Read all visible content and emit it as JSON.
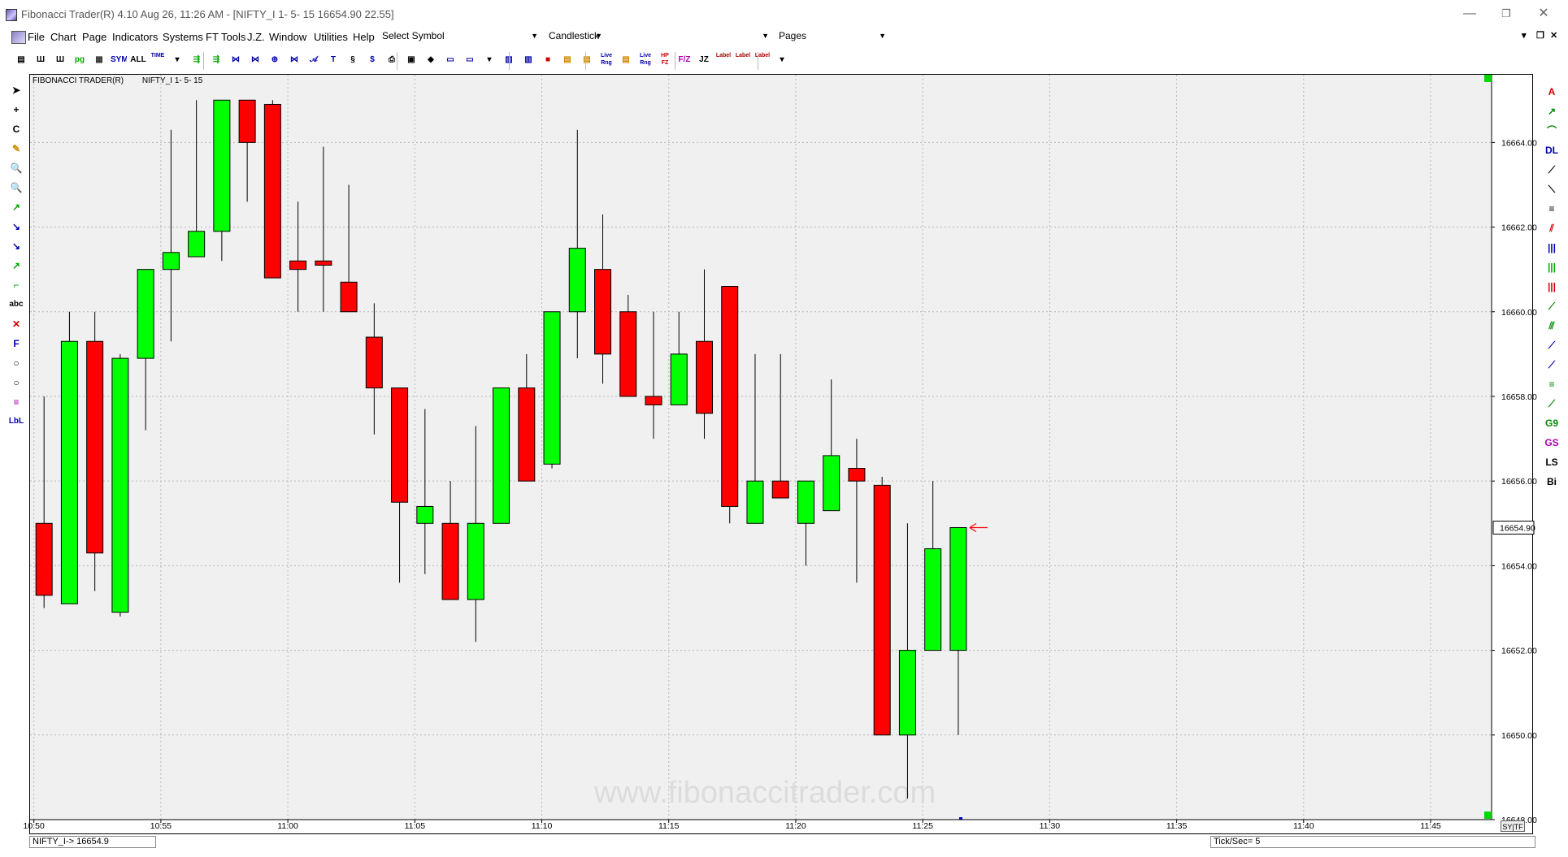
{
  "window": {
    "title": "Fibonacci Trader(R) 4.10 Aug 26,  11:26 AM - [NIFTY_I 1- 5- 15  16654.90   22.55]",
    "minimize": "—",
    "restore": "❐",
    "close": "✕"
  },
  "menu": {
    "items": [
      "File",
      "Chart",
      "Page",
      "Indicators",
      "Systems",
      "FT Tools",
      "J.Z.",
      "Window",
      "Utilities",
      "Help"
    ],
    "symbol_combo": "Select Symbol",
    "chart_type_combo": "Candlestick",
    "empty_combo": "",
    "pages_combo": "Pages",
    "mdi_controls": [
      "▾",
      "❐",
      "✕"
    ]
  },
  "toolbar": {
    "buttons": [
      "▤",
      "Ш",
      "Ш",
      "pg",
      "▦",
      "SYM",
      "ALL",
      "TIME",
      "▾",
      "⇶",
      "⇶",
      "⋈",
      "⋈",
      "⊕",
      "⋈",
      "𝒜",
      "T",
      "§",
      "$",
      "⎙",
      "▣",
      "◆",
      "▭",
      "▭",
      "▾",
      "▥",
      "▥",
      "■",
      "▤",
      "▤",
      "Live Rng",
      "▤",
      "Live Rng",
      "HP FZ",
      "F/Z",
      "JZ",
      "Label",
      "Label",
      "Label",
      "▾"
    ],
    "icons": [
      "page-icon",
      "bars-icon",
      "bars-alt-icon",
      "pg-icon",
      "grid-icon",
      "sym-icon",
      "all-icon",
      "time-icon",
      "dropdown-icon",
      "move-left-icon",
      "move-right-icon",
      "compress-icon",
      "expand-icon",
      "center-icon",
      "zoom-icon",
      "draw-icon",
      "text-icon",
      "stamp-icon",
      "dollar-icon",
      "print-icon",
      "save-icon",
      "diamond-icon",
      "window-icon",
      "window-alt-icon",
      "dropdown-icon",
      "tile-icon",
      "tile-alt-icon",
      "block-icon",
      "table-icon",
      "table-alt-icon",
      "live-range-icon",
      "table-icon",
      "live-range-alt-icon",
      "hp-fz-icon",
      "fz-icon",
      "jz-icon",
      "label-icon",
      "label-alt-icon",
      "label-fib-icon",
      "dropdown-icon"
    ]
  },
  "left_tools": {
    "labels": [
      "➤",
      "+",
      "C",
      "✎",
      "🔍",
      "🔍",
      "↗",
      "↘",
      "↘",
      "↗",
      "⌐",
      "abc",
      "✕",
      "F",
      "○",
      "○",
      "≡",
      "LbL"
    ],
    "icons": [
      "pointer-icon",
      "crosshair-icon",
      "cursor-icon",
      "pencil-icon",
      "zoom-in-icon",
      "zoom-out-icon",
      "trendline-icon",
      "trendline-down-icon",
      "arrow-line-icon",
      "ray-icon",
      "step-icon",
      "text-tool-icon",
      "delete-icon",
      "fib-f-icon",
      "circle-icon",
      "ellipse-icon",
      "lines-icon",
      "label-tool-icon"
    ]
  },
  "right_tools": {
    "labels": [
      "A",
      "↗",
      "⌒",
      "DL",
      "⟋",
      "⟍",
      "≡",
      "⫽",
      "|||",
      "|||",
      "|||",
      "⟋",
      "⫻",
      "⟋",
      "⟋",
      "≡",
      "⟋",
      "G9",
      "GS",
      "LS",
      "Bi"
    ],
    "icons": [
      "andrews-icon",
      "fan-icon",
      "arc-icon",
      "dl-icon",
      "channel-icon",
      "channel-down-icon",
      "horizontal-lines-icon",
      "parallel-icon",
      "time-zones-blue-icon",
      "time-zones-green-icon",
      "time-zones-red-icon",
      "fib-fan-icon",
      "speed-lines-icon",
      "gann-line-icon",
      "gann-fan-icon",
      "fib-retrace-icon",
      "gann-grid-icon",
      "g9-icon",
      "gs-icon",
      "ls-icon",
      "bi-icon"
    ]
  },
  "chart_header": {
    "brand": "FIBONACCI TRADER(R)",
    "symbol": "NIFTY_I 1- 5- 15"
  },
  "status": {
    "symbol_price": "NIFTY_I->  16654.9",
    "ticks": "Tick/Sec=  5",
    "sytf": "SY|TF"
  },
  "chart_data": {
    "type": "candlestick",
    "watermark": "www.fibonaccitrader.com",
    "last_price_label": "16654.90",
    "last_price": 16654.9,
    "ylim": [
      16648,
      16665.6
    ],
    "y_ticks": [
      16664,
      16662,
      16660,
      16658,
      16656,
      16654,
      16652,
      16650,
      16648
    ],
    "y_tick_labels": [
      "16664.00",
      "16662.00",
      "16660.00",
      "16658.00",
      "16656.00",
      "16654.00",
      "16652.00",
      "16650.00",
      "16648.00"
    ],
    "x_ticks": [
      "10:50",
      "10:55",
      "11:00",
      "11:05",
      "11:10",
      "11:15",
      "11:20",
      "11:25",
      "11:30",
      "11:35",
      "11:40",
      "11:45"
    ],
    "x_tick_minutes": [
      650,
      655,
      660,
      665,
      670,
      675,
      680,
      685,
      690,
      695,
      700,
      705
    ],
    "x_range_minutes": [
      649.85,
      707.4
    ],
    "grid": true,
    "up_color": "#00ff00",
    "down_color": "#ff0000",
    "candles": [
      {
        "t": 650.4,
        "open": 16655.0,
        "high": 16658.0,
        "low": 16653.0,
        "close": 16653.3
      },
      {
        "t": 651.4,
        "open": 16653.1,
        "high": 16660.0,
        "low": 16653.1,
        "close": 16659.3
      },
      {
        "t": 652.4,
        "open": 16659.3,
        "high": 16660.0,
        "low": 16653.4,
        "close": 16654.3
      },
      {
        "t": 653.4,
        "open": 16652.9,
        "high": 16659.0,
        "low": 16652.8,
        "close": 16658.9
      },
      {
        "t": 654.4,
        "open": 16658.9,
        "high": 16661.0,
        "low": 16657.2,
        "close": 16661.0
      },
      {
        "t": 655.4,
        "open": 16661.0,
        "high": 16664.3,
        "low": 16659.3,
        "close": 16661.4
      },
      {
        "t": 656.4,
        "open": 16661.3,
        "high": 16665.0,
        "low": 16661.3,
        "close": 16661.9
      },
      {
        "t": 657.4,
        "open": 16661.9,
        "high": 16665.0,
        "low": 16661.2,
        "close": 16665.0
      },
      {
        "t": 658.4,
        "open": 16665.0,
        "high": 16665.0,
        "low": 16662.6,
        "close": 16664.0
      },
      {
        "t": 659.4,
        "open": 16664.9,
        "high": 16665.0,
        "low": 16660.8,
        "close": 16660.8
      },
      {
        "t": 660.4,
        "open": 16661.2,
        "high": 16662.6,
        "low": 16660.0,
        "close": 16661.0
      },
      {
        "t": 661.4,
        "open": 16661.2,
        "high": 16663.9,
        "low": 16660.0,
        "close": 16661.1
      },
      {
        "t": 662.4,
        "open": 16660.7,
        "high": 16663.0,
        "low": 16660.0,
        "close": 16660.0
      },
      {
        "t": 663.4,
        "open": 16659.4,
        "high": 16660.2,
        "low": 16657.1,
        "close": 16658.2
      },
      {
        "t": 664.4,
        "open": 16658.2,
        "high": 16658.2,
        "low": 16653.6,
        "close": 16655.5
      },
      {
        "t": 665.4,
        "open": 16655.0,
        "high": 16657.7,
        "low": 16653.8,
        "close": 16655.4
      },
      {
        "t": 666.4,
        "open": 16655.0,
        "high": 16656.0,
        "low": 16653.2,
        "close": 16653.2
      },
      {
        "t": 667.4,
        "open": 16653.2,
        "high": 16657.3,
        "low": 16652.2,
        "close": 16655.0
      },
      {
        "t": 668.4,
        "open": 16655.0,
        "high": 16658.2,
        "low": 16655.0,
        "close": 16658.2
      },
      {
        "t": 669.4,
        "open": 16658.2,
        "high": 16659.0,
        "low": 16656.0,
        "close": 16656.0
      },
      {
        "t": 670.4,
        "open": 16656.4,
        "high": 16660.0,
        "low": 16656.3,
        "close": 16660.0
      },
      {
        "t": 671.4,
        "open": 16660.0,
        "high": 16664.3,
        "low": 16658.9,
        "close": 16661.5
      },
      {
        "t": 672.4,
        "open": 16661.0,
        "high": 16662.3,
        "low": 16658.3,
        "close": 16659.0
      },
      {
        "t": 673.4,
        "open": 16660.0,
        "high": 16660.4,
        "low": 16658.0,
        "close": 16658.0
      },
      {
        "t": 674.4,
        "open": 16658.0,
        "high": 16660.0,
        "low": 16657.0,
        "close": 16657.8
      },
      {
        "t": 675.4,
        "open": 16657.8,
        "high": 16660.0,
        "low": 16657.8,
        "close": 16659.0
      },
      {
        "t": 676.4,
        "open": 16659.3,
        "high": 16661.0,
        "low": 16657.0,
        "close": 16657.6
      },
      {
        "t": 677.4,
        "open": 16660.6,
        "high": 16660.6,
        "low": 16655.0,
        "close": 16655.4
      },
      {
        "t": 678.4,
        "open": 16655.0,
        "high": 16659.0,
        "low": 16655.0,
        "close": 16656.0
      },
      {
        "t": 679.4,
        "open": 16656.0,
        "high": 16659.0,
        "low": 16655.6,
        "close": 16655.6
      },
      {
        "t": 680.4,
        "open": 16655.0,
        "high": 16656.0,
        "low": 16654.0,
        "close": 16656.0
      },
      {
        "t": 681.4,
        "open": 16655.3,
        "high": 16658.4,
        "low": 16655.3,
        "close": 16656.6
      },
      {
        "t": 682.4,
        "open": 16656.3,
        "high": 16657.0,
        "low": 16653.6,
        "close": 16656.0
      },
      {
        "t": 683.4,
        "open": 16655.9,
        "high": 16656.1,
        "low": 16650.0,
        "close": 16650.0
      },
      {
        "t": 684.4,
        "open": 16650.0,
        "high": 16655.0,
        "low": 16648.5,
        "close": 16652.0
      },
      {
        "t": 685.4,
        "open": 16652.0,
        "high": 16656.0,
        "low": 16652.0,
        "close": 16654.4
      },
      {
        "t": 686.4,
        "open": 16652.0,
        "high": 16654.9,
        "low": 16650.0,
        "close": 16654.9
      }
    ]
  }
}
